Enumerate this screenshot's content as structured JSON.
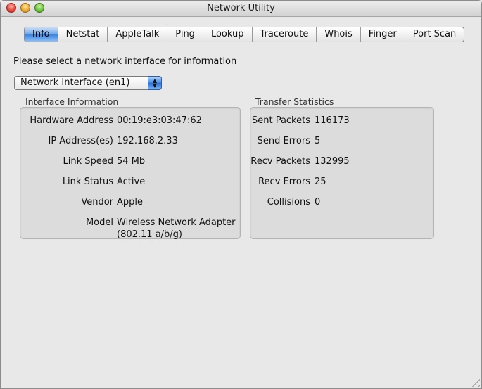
{
  "window": {
    "title": "Network Utility"
  },
  "tabs": [
    {
      "label": "Info",
      "active": true
    },
    {
      "label": "Netstat",
      "active": false
    },
    {
      "label": "AppleTalk",
      "active": false
    },
    {
      "label": "Ping",
      "active": false
    },
    {
      "label": "Lookup",
      "active": false
    },
    {
      "label": "Traceroute",
      "active": false
    },
    {
      "label": "Whois",
      "active": false
    },
    {
      "label": "Finger",
      "active": false
    },
    {
      "label": "Port Scan",
      "active": false
    }
  ],
  "prompt": "Please select a network interface for information",
  "interface_select": {
    "value": "Network Interface (en1)"
  },
  "interface_info": {
    "title": "Interface Information",
    "rows": [
      {
        "label": "Hardware Address",
        "value": "00:19:e3:03:47:62"
      },
      {
        "label": "IP Address(es)",
        "value": "192.168.2.33"
      },
      {
        "label": "Link Speed",
        "value": "54 Mb"
      },
      {
        "label": "Link Status",
        "value": "Active"
      },
      {
        "label": "Vendor",
        "value": "Apple"
      },
      {
        "label": "Model",
        "value": "Wireless Network Adapter",
        "value2": "(802.11 a/b/g)"
      }
    ]
  },
  "transfer_stats": {
    "title": "Transfer Statistics",
    "rows": [
      {
        "label": "Sent Packets",
        "value": "116173"
      },
      {
        "label": "Send Errors",
        "value": "5"
      },
      {
        "label": "Recv Packets",
        "value": "132995"
      },
      {
        "label": "Recv Errors",
        "value": "25"
      },
      {
        "label": "Collisions",
        "value": "0"
      }
    ]
  }
}
